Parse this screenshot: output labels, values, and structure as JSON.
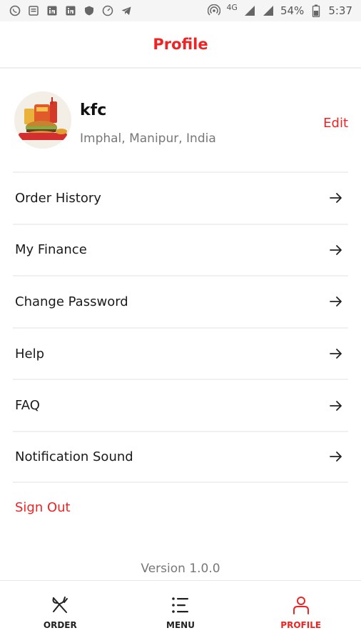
{
  "status_bar": {
    "network": "4G",
    "battery": "54%",
    "time": "5:37",
    "icons": [
      "whatsapp-icon",
      "news-icon",
      "linkedin-icon",
      "linkedin-icon",
      "shield-icon",
      "speed-icon",
      "telegram-icon",
      "hotspot-icon",
      "signal-icon",
      "signal-icon",
      "battery-icon"
    ]
  },
  "header": {
    "title": "Profile"
  },
  "profile": {
    "name": "kfc",
    "location": "Imphal, Manipur, India",
    "edit_label": "Edit",
    "avatar_icon": "food-avatar"
  },
  "menu": {
    "items": [
      {
        "label": "Order History"
      },
      {
        "label": "My Finance"
      },
      {
        "label": "Change Password"
      },
      {
        "label": "Help"
      },
      {
        "label": "FAQ"
      },
      {
        "label": "Notification Sound"
      }
    ],
    "arrow_icon": "arrow-right-icon"
  },
  "sign_out_label": "Sign Out",
  "version": "Version 1.0.0",
  "bottom_nav": {
    "items": [
      {
        "label": "ORDER",
        "icon": "fork-knife-icon",
        "active": false
      },
      {
        "label": "MENU",
        "icon": "list-icon",
        "active": false
      },
      {
        "label": "PROFILE",
        "icon": "user-icon",
        "active": true
      }
    ]
  },
  "colors": {
    "accent": "#ef2323",
    "text": "#1a1a1a",
    "muted": "#777777"
  }
}
